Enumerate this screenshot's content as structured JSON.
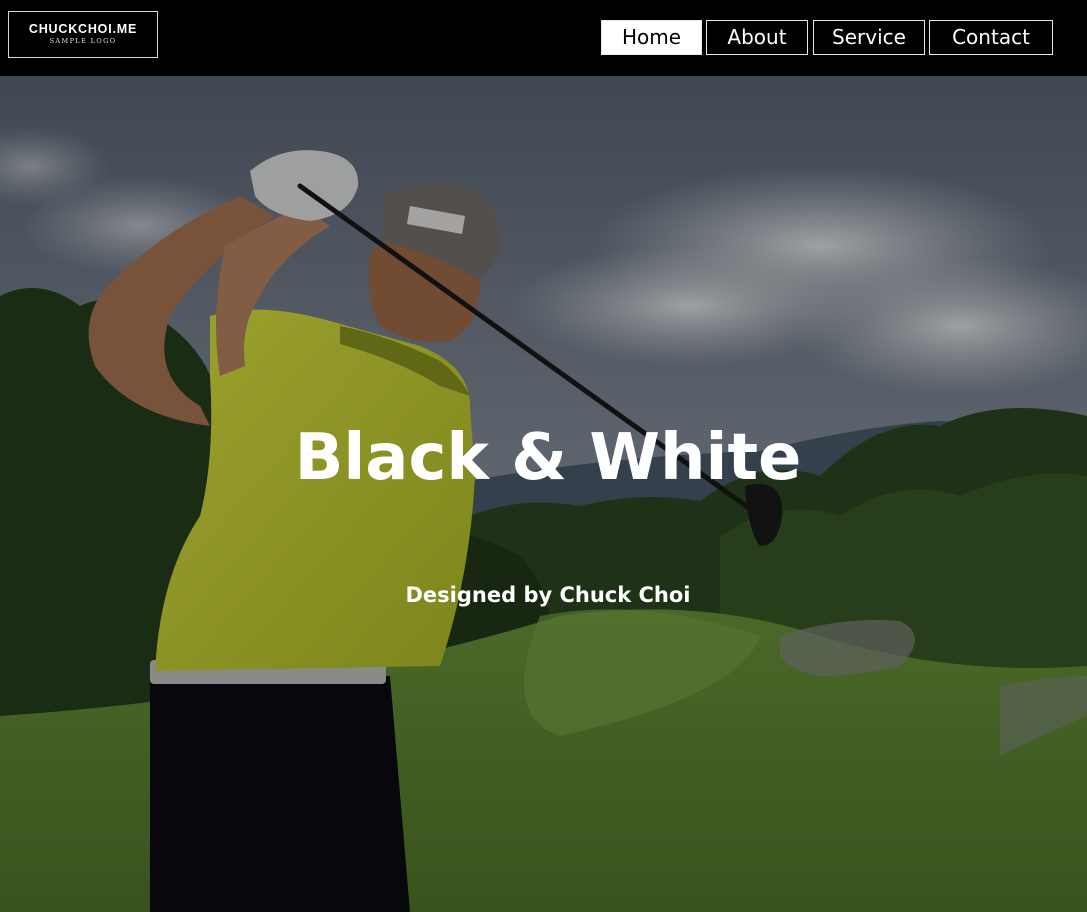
{
  "header": {
    "logo": {
      "title": "CHUCKCHOI.ME",
      "subtitle": "SAMPLE LOGO"
    },
    "nav": [
      {
        "label": "Home",
        "active": true
      },
      {
        "label": "About",
        "active": false
      },
      {
        "label": "Service",
        "active": false
      },
      {
        "label": "Contact",
        "active": false
      }
    ]
  },
  "hero": {
    "title": "Black & White",
    "subtitle": "Designed by Chuck Choi",
    "background_image": "golfer-swing-photo",
    "overlay_color": "#000000"
  },
  "colors": {
    "header_bg": "#000000",
    "nav_active_bg": "#ffffff",
    "text": "#ffffff"
  }
}
